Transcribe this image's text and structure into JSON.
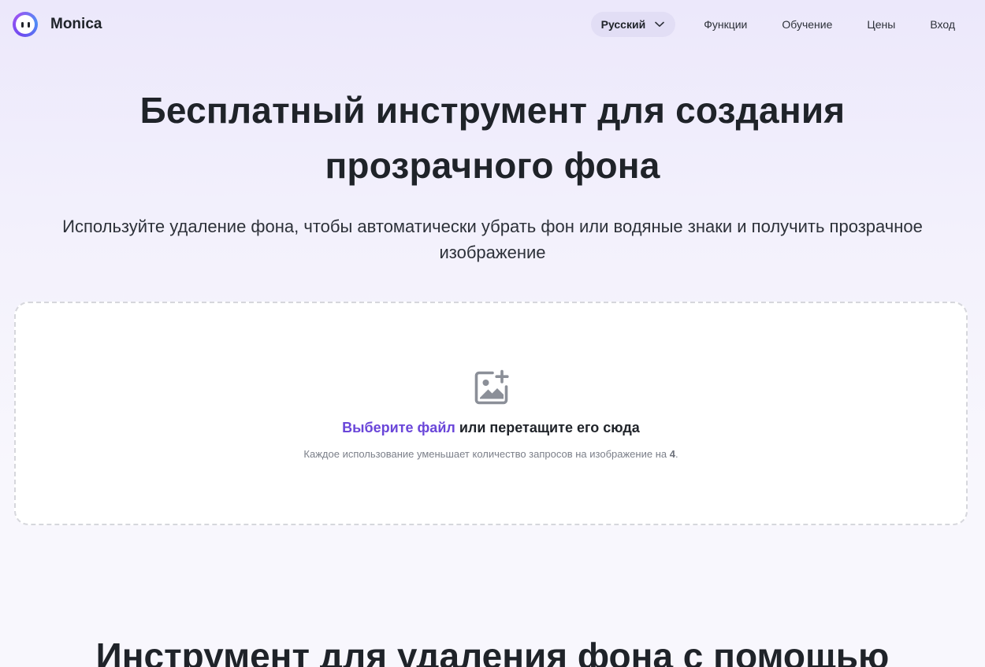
{
  "header": {
    "brand_name": "Monica",
    "language": {
      "label": "Русский",
      "icon": "chevron-down-icon"
    },
    "nav": [
      {
        "label": "Функции"
      },
      {
        "label": "Обучение"
      },
      {
        "label": "Цены"
      },
      {
        "label": "Вход"
      }
    ]
  },
  "hero": {
    "title_line1": "Бесплатный инструмент для создания",
    "title_line2": "прозрачного фона",
    "subtitle": "Используйте удаление фона, чтобы автоматически убрать фон или водяные знаки и получить прозрачное изображение"
  },
  "upload": {
    "icon": "image-add-icon",
    "choose_file": "Выберите файл",
    "drag_text": " или перетащите его сюда",
    "note_prefix": "Каждое использование уменьшает количество запросов на изображение на ",
    "note_count": "4",
    "note_suffix": "."
  },
  "section": {
    "title": "Инструмент для удаления фона с помощью"
  },
  "colors": {
    "accent": "#6a46d9",
    "text": "#1f2329",
    "lang_pill_bg": "#e2def5",
    "background_top": "#ece8fb",
    "background_bottom": "#f8f7fd"
  }
}
